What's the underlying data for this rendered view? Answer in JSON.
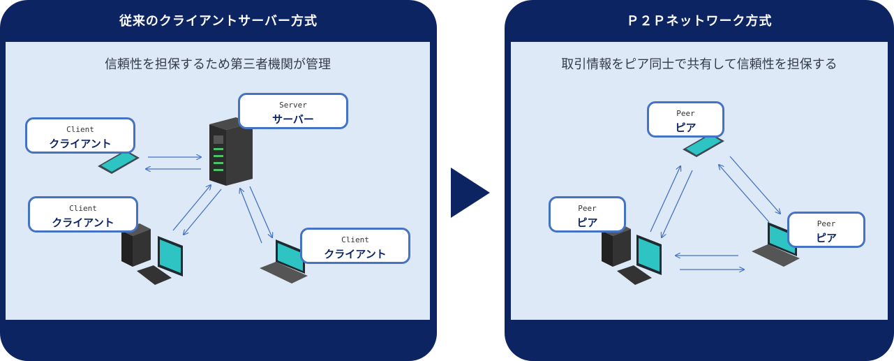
{
  "left_panel": {
    "title": "従来のクライアントサーバー方式",
    "subtitle": "信頼性を担保するため第三者機関が管理",
    "server_label": {
      "en": "Server",
      "jp": "サーバー"
    },
    "client_labels": [
      {
        "en": "Client",
        "jp": "クライアント"
      },
      {
        "en": "Client",
        "jp": "クライアント"
      },
      {
        "en": "Client",
        "jp": "クライアント"
      }
    ]
  },
  "right_panel": {
    "title": "Ｐ２Ｐネットワーク方式",
    "subtitle": "取引情報をピア同士で共有して信頼性を担保する",
    "peer_labels": [
      {
        "en": "Peer",
        "jp": "ピア"
      },
      {
        "en": "Peer",
        "jp": "ピア"
      },
      {
        "en": "Peer",
        "jp": "ピア"
      }
    ]
  },
  "colors": {
    "frame": "#0d2463",
    "panel_bg": "#dde9f6",
    "label_border": "#4472c4",
    "arrow": "#4472c4",
    "device_screen": "#2ec4c4"
  },
  "icons": [
    "server-icon",
    "tablet-icon",
    "desktop-pc-icon",
    "laptop-icon",
    "right-triangle-arrow-icon"
  ]
}
